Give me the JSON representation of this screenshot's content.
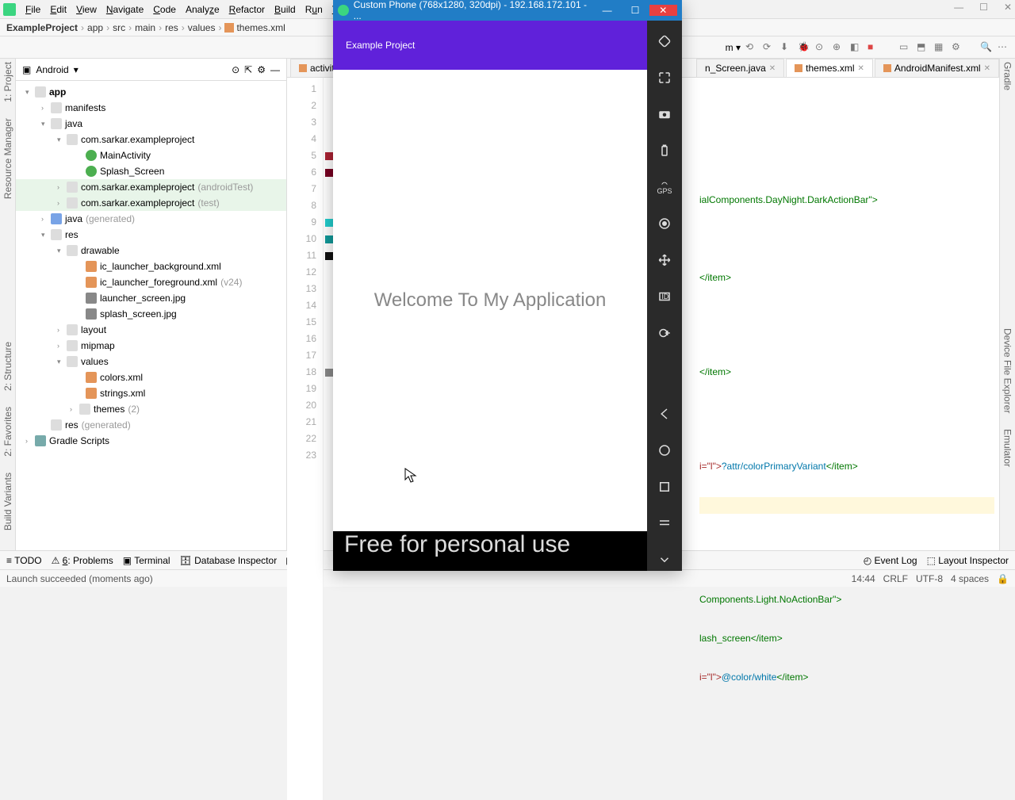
{
  "menu": {
    "items": [
      "File",
      "Edit",
      "View",
      "Navigate",
      "Code",
      "Analyze",
      "Refactor",
      "Build",
      "Run",
      "Tools"
    ]
  },
  "winbtn": {
    "min": "—",
    "max": "☐",
    "close": "✕"
  },
  "breadcrumb": {
    "project": "ExampleProject",
    "app": "app",
    "src": "src",
    "main": "main",
    "res": "res",
    "values": "values",
    "file": "themes.xml"
  },
  "project": {
    "label": "Android"
  },
  "tree": {
    "app": "app",
    "manifests": "manifests",
    "java": "java",
    "pkg": "com.sarkar.exampleproject",
    "main_activity": "MainActivity",
    "splash": "Splash_Screen",
    "pkg_at": "com.sarkar.exampleproject",
    "at": "(androidTest)",
    "pkg_t": "com.sarkar.exampleproject",
    "tt": "(test)",
    "java_gen": "java",
    "gen": "(generated)",
    "res": "res",
    "drawable": "drawable",
    "ic_bg": "ic_launcher_background.xml",
    "ic_fg": "ic_launcher_foreground.xml",
    "v24": "(v24)",
    "launcher": "launcher_screen.jpg",
    "splashimg": "splash_screen.jpg",
    "layout": "layout",
    "mipmap": "mipmap",
    "values": "values",
    "colors": "colors.xml",
    "strings": "strings.xml",
    "themes": "themes",
    "two": "(2)",
    "res_gen": "res",
    "rgen": "(generated)",
    "gradle": "Gradle Scripts"
  },
  "tabs": {
    "t1": "activity",
    "t2": "n_Screen.java",
    "t3": "themes.xml",
    "t4": "AndroidManifest.xml"
  },
  "code": {
    "l5": "ialComponents.DayNight.DarkActionBar\">",
    "l7": "</item>",
    "l10": "</item>",
    "l13a": "i=\"l\">",
    "l13b": "?attr/colorPrimaryVariant",
    "l13c": "</item>",
    "l17": "Components.Light.NoActionBar\">",
    "l18": "lash_screen</item>",
    "l19a": "i=\"l\">",
    "l19b": "@color/white",
    "l19c": "</item>"
  },
  "bottom": {
    "todo": "TODO",
    "prob": "Problems",
    "term": "Terminal",
    "db": "Database Inspector",
    "pr": "P",
    "evlog": "Event Log",
    "layout": "Layout Inspector"
  },
  "status": {
    "msg": "Launch succeeded (moments ago)",
    "pos": "14:44",
    "crlf": "CRLF",
    "enc": "UTF-8",
    "sp": "4 spaces"
  },
  "emu": {
    "title": "Custom Phone (768x1280, 320dpi) - 192.168.172.101 - ...",
    "appbar": "Example Project",
    "welcome": "Welcome To My Application",
    "footer": "Free for personal use"
  },
  "leftRail": {
    "p": "1: Project",
    "rm": "Resource Manager",
    "s": "2: Structure",
    "f": "2: Favorites",
    "bv": "Build Variants"
  },
  "rightRail": {
    "g": "Gradle",
    "d": "Device File Explorer",
    "e": "Emulator"
  },
  "tbtext": {
    "m": "m ▾"
  }
}
